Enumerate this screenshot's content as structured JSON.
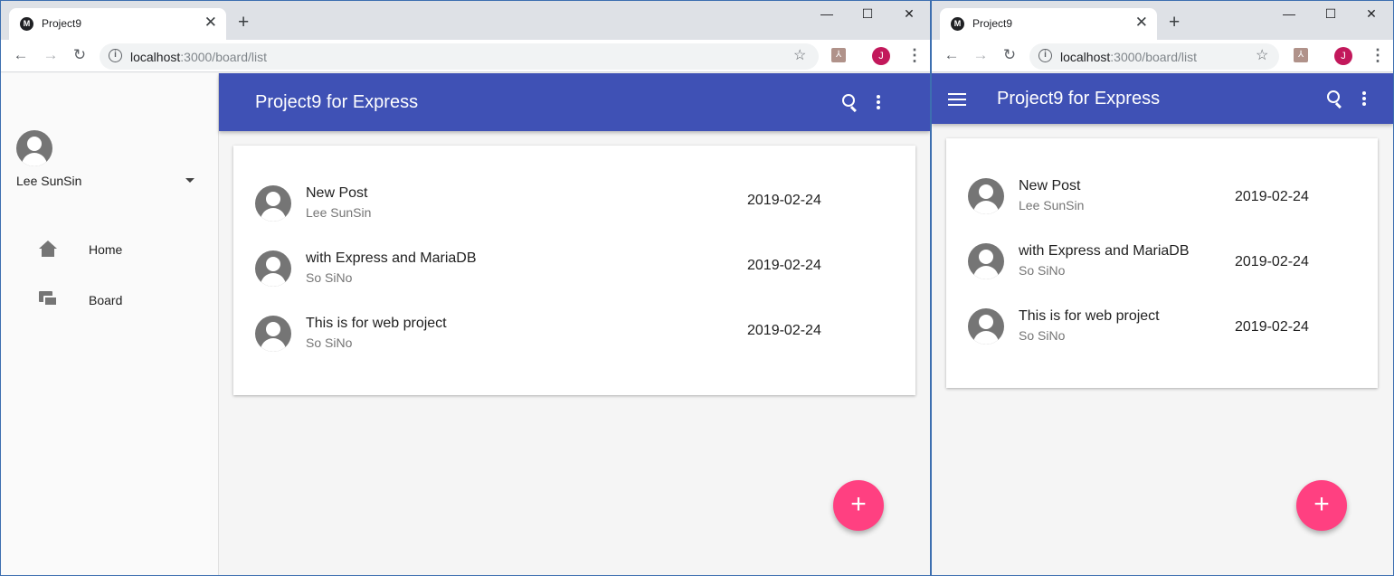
{
  "colors": {
    "appbar": "#3f51b5",
    "fab": "#ff4081",
    "avatar": "#757575",
    "profile": "#c2185b"
  },
  "browser": {
    "tab_title": "Project9",
    "tab_favicon": "M",
    "tab_close": "✕",
    "new_tab": "+",
    "minimize": "—",
    "maximize": "☐",
    "close": "✕",
    "back": "←",
    "forward": "→",
    "reload": "↻",
    "info": "i",
    "url_host": "localhost",
    "url_path": ":3000/board/list",
    "star": "☆",
    "pdf": "⅄",
    "profile_initial": "J",
    "menu": "⋮"
  },
  "drawer": {
    "user_name": "Lee SunSin",
    "items": [
      {
        "label": "Home",
        "icon": "home-icon"
      },
      {
        "label": "Board",
        "icon": "forum-icon"
      }
    ]
  },
  "appbar": {
    "title": "Project9 for Express"
  },
  "posts": [
    {
      "title": "New Post",
      "author": "Lee SunSin",
      "date": "2019-02-24"
    },
    {
      "title": "with Express and MariaDB",
      "author": "So SiNo",
      "date": "2019-02-24"
    },
    {
      "title": "This is for web project",
      "author": "So SiNo",
      "date": "2019-02-24"
    }
  ],
  "fab": {
    "label": "+"
  }
}
